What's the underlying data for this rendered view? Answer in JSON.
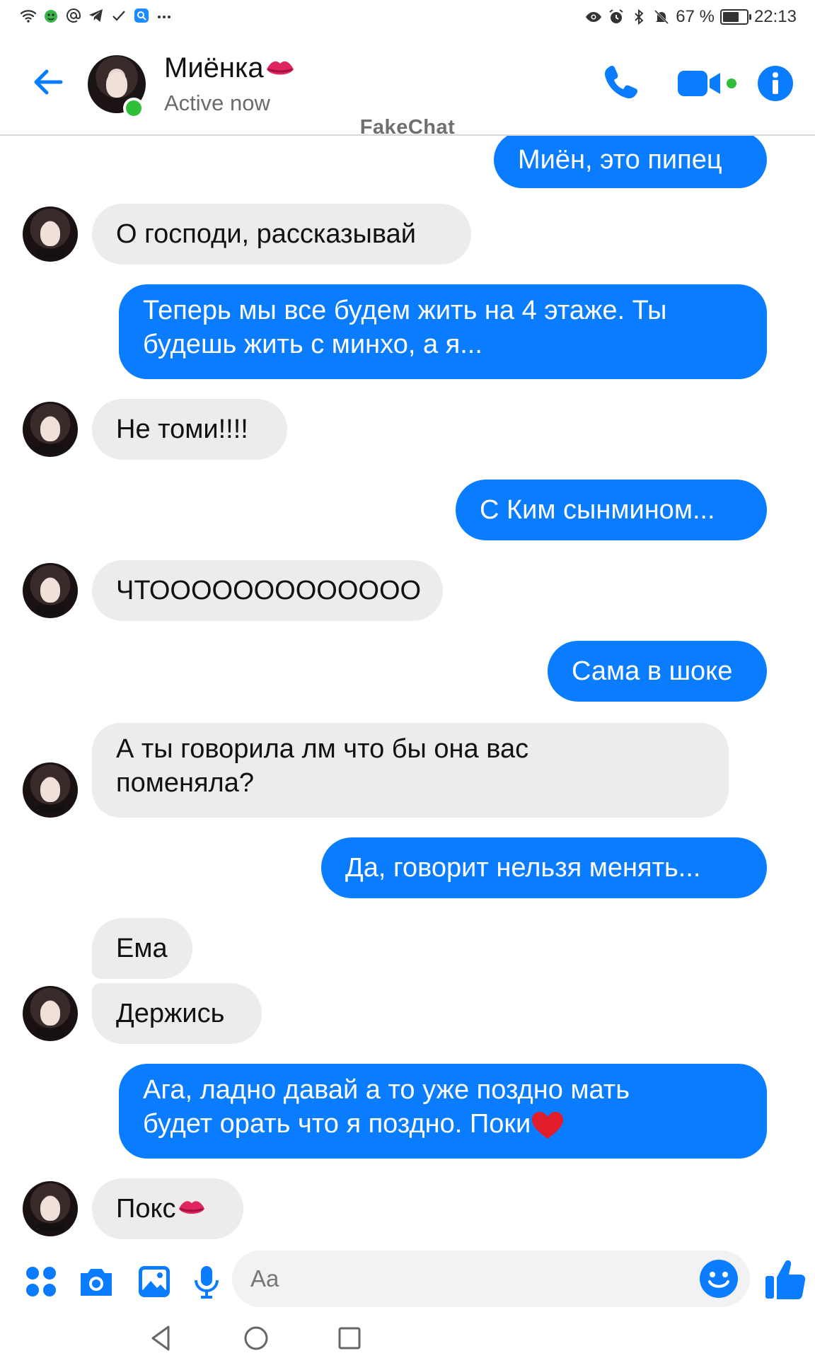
{
  "status_bar": {
    "battery": "67 %",
    "time": "22:13",
    "left_icons": [
      "wifi-icon",
      "android-icon",
      "at-icon",
      "telegram-icon",
      "check-icon",
      "search-app-icon",
      "more-dots-icon"
    ],
    "right_icons": [
      "eye-icon",
      "alarm-icon",
      "bluetooth-icon",
      "mute-icon",
      "battery-icon"
    ]
  },
  "header": {
    "contact_name": "Миёнка",
    "contact_name_emoji": "kiss-lips-emoji",
    "status": "Active now",
    "watermark": "FakeChat"
  },
  "messages": [
    {
      "dir": "out",
      "text": "Миён, это пипец"
    },
    {
      "dir": "in",
      "text": "О господи, рассказывай"
    },
    {
      "dir": "out",
      "lines": [
        "Теперь мы все будем жить на 4 этаже. Ты",
        "будешь жить с минхо, а я..."
      ]
    },
    {
      "dir": "in",
      "text": "Не томи!!!!"
    },
    {
      "dir": "out",
      "text": "С Ким сынмином..."
    },
    {
      "dir": "in",
      "text": "ЧТООООООООООООО"
    },
    {
      "dir": "out",
      "text": "Сама в шоке"
    },
    {
      "dir": "in",
      "lines": [
        "А ты говорила лм что бы она вас",
        "поменяла?"
      ]
    },
    {
      "dir": "out",
      "text": "Да, говорит нельзя менять..."
    },
    {
      "dir": "in",
      "text": "Ема"
    },
    {
      "dir": "in",
      "text": "Держись"
    },
    {
      "dir": "out",
      "lines": [
        "Ага, ладно давай а то уже поздно мать",
        "будет орать что я поздно. Поки"
      ],
      "trailing_emoji": "red-heart-emoji"
    },
    {
      "dir": "in",
      "text": "Покс",
      "trailing_emoji": "kiss-lips-emoji"
    }
  ],
  "composer": {
    "placeholder": "Aa",
    "buttons": [
      "apps-icon",
      "camera-icon",
      "gallery-icon",
      "microphone-icon",
      "emoji-icon",
      "thumbs-up-icon"
    ]
  },
  "navbar": {
    "buttons": [
      "back-triangle-icon",
      "home-circle-icon",
      "recents-square-icon"
    ]
  },
  "colors": {
    "accent": "#0a7cff",
    "incoming_bubble": "#ececec",
    "online": "#2fbf3a"
  }
}
